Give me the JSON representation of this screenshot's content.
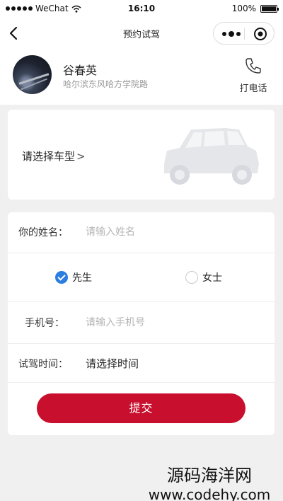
{
  "status_bar": {
    "carrier": "WeChat",
    "time": "16:10",
    "battery": "100%"
  },
  "nav": {
    "title": "预约试驾"
  },
  "dealer": {
    "name": "谷春英",
    "address": "哈尔滨东风哈方学院路",
    "call_label": "打电话"
  },
  "car": {
    "select_label": "请选择车型",
    "chevron": ">"
  },
  "form": {
    "name_label": "你的姓名：",
    "name_placeholder": "请输入姓名",
    "gender_options": [
      {
        "label": "先生",
        "checked": true
      },
      {
        "label": "女士",
        "checked": false
      }
    ],
    "phone_label": "手机号：",
    "phone_placeholder": "请输入手机号",
    "time_label": "试驾时间：",
    "time_value": "请选择时间",
    "submit_label": "提交"
  },
  "watermark": {
    "line1": "源码海洋网",
    "line2": "www.codehy.com"
  },
  "colors": {
    "accent_red": "#c8102e",
    "radio_blue": "#2a7ee0",
    "page_bg": "#f0f0f0"
  }
}
